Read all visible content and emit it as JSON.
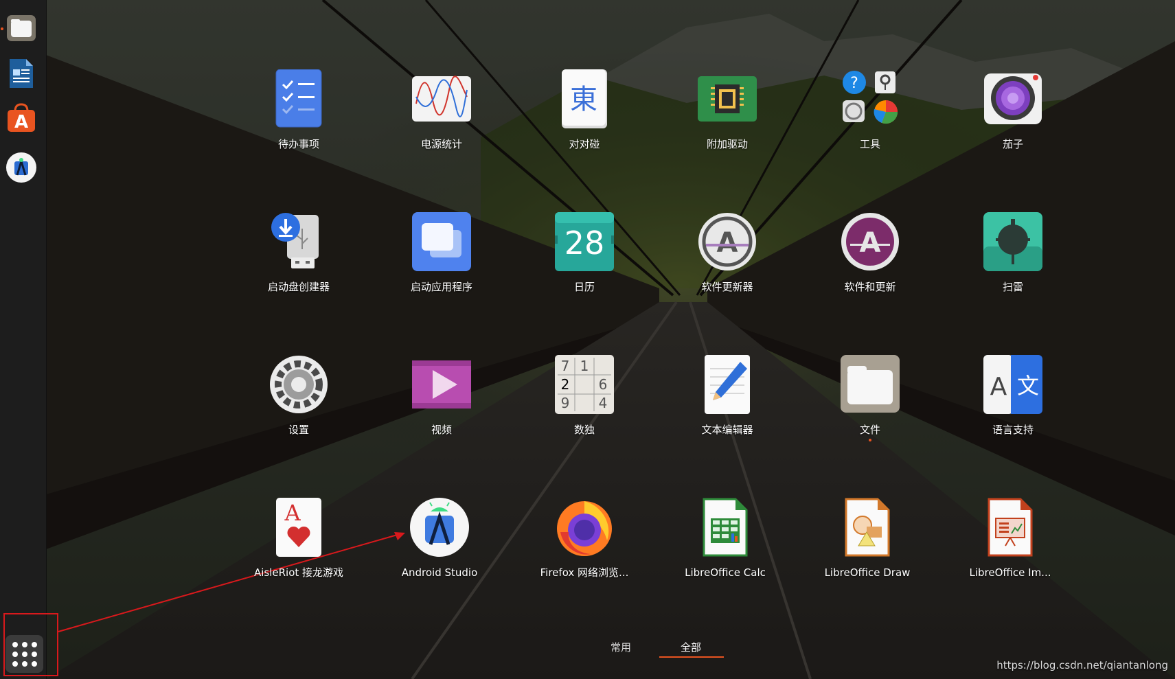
{
  "dock": {
    "items": [
      {
        "name": "files",
        "icon": "folder-icon"
      },
      {
        "name": "libreoffice-writer",
        "icon": "document-icon"
      },
      {
        "name": "ubuntu-software",
        "icon": "software-store-icon"
      },
      {
        "name": "android-studio",
        "icon": "android-studio-icon"
      }
    ],
    "show_apps_icon": "grid-icon"
  },
  "apps": [
    {
      "label": "待办事项",
      "icon": "todo-icon"
    },
    {
      "label": "电源统计",
      "icon": "power-statistics-icon"
    },
    {
      "label": "对对碰",
      "icon": "mahjongg-icon",
      "glyph": "東"
    },
    {
      "label": "附加驱动",
      "icon": "chip-icon"
    },
    {
      "label": "工具",
      "icon": "utilities-folder-icon",
      "glyph": "?"
    },
    {
      "label": "茄子",
      "icon": "camera-icon"
    },
    {
      "label": "启动盘创建器",
      "icon": "usb-creator-icon"
    },
    {
      "label": "启动应用程序",
      "icon": "startup-apps-icon"
    },
    {
      "label": "日历",
      "icon": "calendar-icon",
      "glyph": "28"
    },
    {
      "label": "软件更新器",
      "icon": "software-updater-icon",
      "glyph": "A"
    },
    {
      "label": "软件和更新",
      "icon": "software-properties-icon",
      "glyph": "A"
    },
    {
      "label": "扫雷",
      "icon": "mines-icon"
    },
    {
      "label": "设置",
      "icon": "settings-gear-icon"
    },
    {
      "label": "视频",
      "icon": "video-player-icon"
    },
    {
      "label": "数独",
      "icon": "sudoku-icon",
      "digits": [
        "7",
        "1",
        "2",
        "6",
        "9",
        "4"
      ]
    },
    {
      "label": "文本编辑器",
      "icon": "text-editor-icon"
    },
    {
      "label": "文件",
      "icon": "folder-icon"
    },
    {
      "label": "语言支持",
      "icon": "language-icon",
      "glyphs": [
        "A",
        "文"
      ]
    },
    {
      "label": "AisleRiot 接龙游戏",
      "icon": "solitaire-icon",
      "glyph": "A"
    },
    {
      "label": "Android Studio",
      "icon": "android-studio-icon"
    },
    {
      "label": "Firefox 网络浏览...",
      "icon": "firefox-icon"
    },
    {
      "label": "LibreOffice Calc",
      "icon": "libreoffice-calc-icon"
    },
    {
      "label": "LibreOffice Draw",
      "icon": "libreoffice-draw-icon"
    },
    {
      "label": "LibreOffice Im...",
      "icon": "libreoffice-impress-icon"
    }
  ],
  "tabs": {
    "frequent": "常用",
    "all": "全部",
    "active": "全部"
  },
  "watermark": "https://blog.csdn.net/qiantanlong",
  "colors": {
    "accent": "#e95420",
    "annotation": "#d9191c"
  }
}
